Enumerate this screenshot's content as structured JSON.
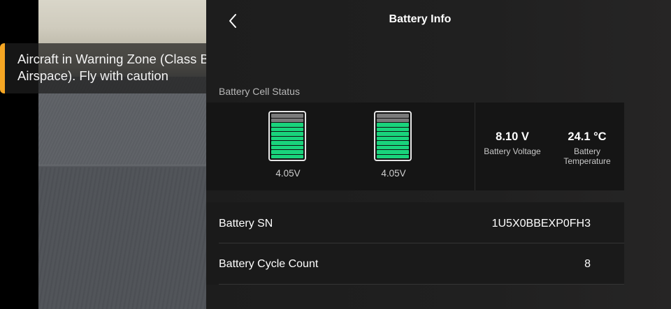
{
  "warning": {
    "line1": "Aircraft in Warning Zone (Class B",
    "line2": "Airspace). Fly with caution"
  },
  "header": {
    "title": "Battery Info",
    "back_icon": "chevron-left-icon"
  },
  "cell_status": {
    "label": "Battery Cell Status",
    "cells": [
      {
        "voltage": "4.05V",
        "level_segments": 8,
        "total_segments": 10
      },
      {
        "voltage": "4.05V",
        "level_segments": 8,
        "total_segments": 10
      }
    ],
    "voltage": {
      "value": "8.10 V",
      "label": "Battery Voltage"
    },
    "temperature": {
      "value": "24.1 °C",
      "label_line1": "Battery",
      "label_line2": "Temperature"
    }
  },
  "info": {
    "sn_label": "Battery SN",
    "sn_value": "1U5X0BBEXP0FH3",
    "cycle_label": "Battery Cycle Count",
    "cycle_value": "8"
  },
  "colors": {
    "warning_accent": "#f5a623",
    "cell_green": "#19d47c",
    "cell_gray": "#7a7a7a"
  }
}
